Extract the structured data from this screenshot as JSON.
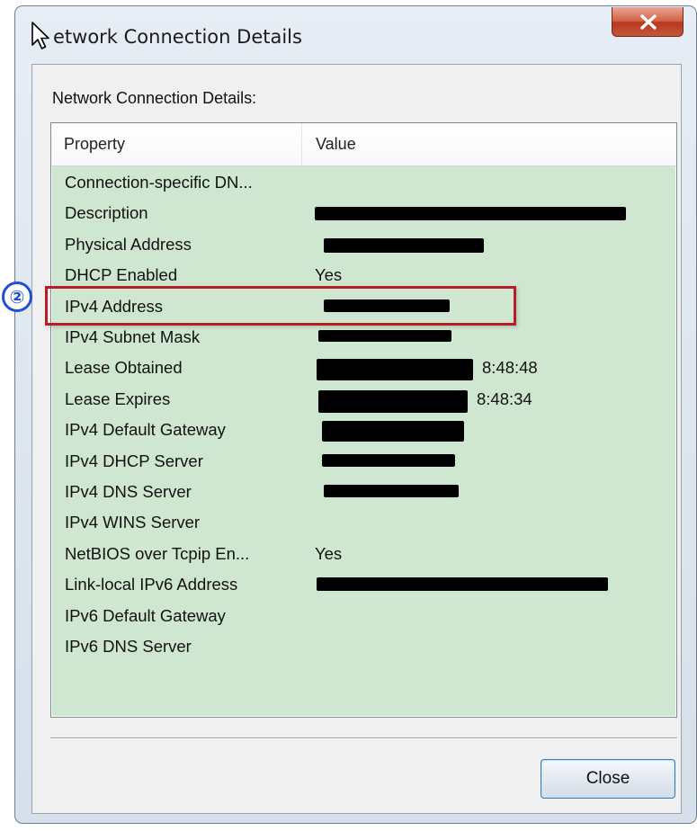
{
  "window": {
    "title": "etwork Connection Details",
    "close_glyph": "X"
  },
  "dialog": {
    "group_label": "Network Connection Details:",
    "columns": {
      "property": "Property",
      "value": "Value"
    },
    "rows": [
      {
        "property": "Connection-specific DN...",
        "value": ""
      },
      {
        "property": "Description",
        "value": ""
      },
      {
        "property": "Physical Address",
        "value": ""
      },
      {
        "property": "DHCP Enabled",
        "value": "Yes"
      },
      {
        "property": "IPv4 Address",
        "value": ""
      },
      {
        "property": "IPv4 Subnet Mask",
        "value": ""
      },
      {
        "property": "Lease Obtained",
        "value": "8:48:48"
      },
      {
        "property": "Lease Expires",
        "value": "8:48:34"
      },
      {
        "property": "IPv4 Default Gateway",
        "value": ""
      },
      {
        "property": "IPv4 DHCP Server",
        "value": ""
      },
      {
        "property": "IPv4 DNS Server",
        "value": ""
      },
      {
        "property": "IPv4 WINS Server",
        "value": ""
      },
      {
        "property": "NetBIOS over Tcpip En...",
        "value": "Yes"
      },
      {
        "property": "Link-local IPv6 Address",
        "value": ""
      },
      {
        "property": "IPv6 Default Gateway",
        "value": ""
      },
      {
        "property": "IPv6 DNS Server",
        "value": ""
      }
    ],
    "close_label": "Close"
  },
  "annotation": {
    "step_marker": "②"
  },
  "colors": {
    "list_background": "#cfe7d1",
    "highlight_border": "#b51e22",
    "marker_blue": "#1f4fd6",
    "redaction": "#000000"
  },
  "icons": {
    "window_close": "close-icon",
    "pointer": "mouse-cursor-icon"
  }
}
